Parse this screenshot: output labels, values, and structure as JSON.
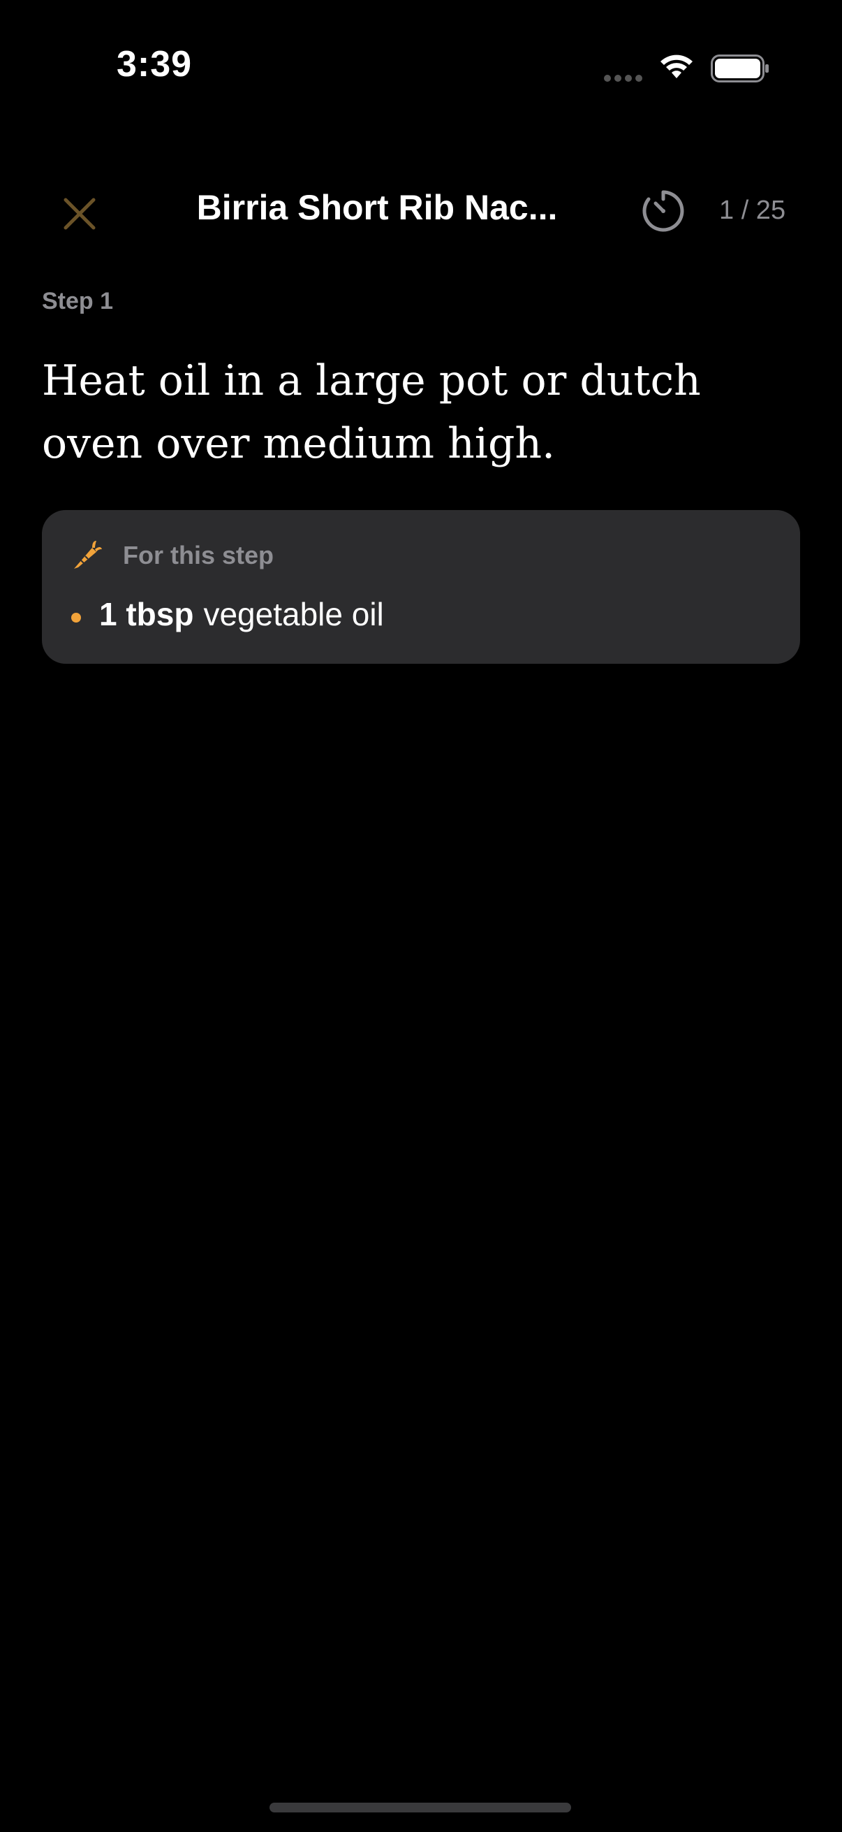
{
  "status_bar": {
    "time": "3:39"
  },
  "nav": {
    "title": "Birria Short Rib Nac...",
    "step_counter": "1 / 25"
  },
  "step": {
    "label": "Step 1",
    "text": "Heat oil in a large pot or dutch oven over medium high."
  },
  "ingredients_card": {
    "header": "For this step",
    "items": [
      {
        "quantity": "1 tbsp",
        "name": "vegetable oil"
      }
    ]
  },
  "colors": {
    "background": "#000000",
    "card": "#2c2c2e",
    "accent": "#f2a33a",
    "close_icon": "#6b5328",
    "secondary_text": "#8e8e93"
  },
  "icons": [
    "signal-icon",
    "wifi-icon",
    "battery-icon",
    "close-icon",
    "timer-icon",
    "carrot-icon"
  ]
}
